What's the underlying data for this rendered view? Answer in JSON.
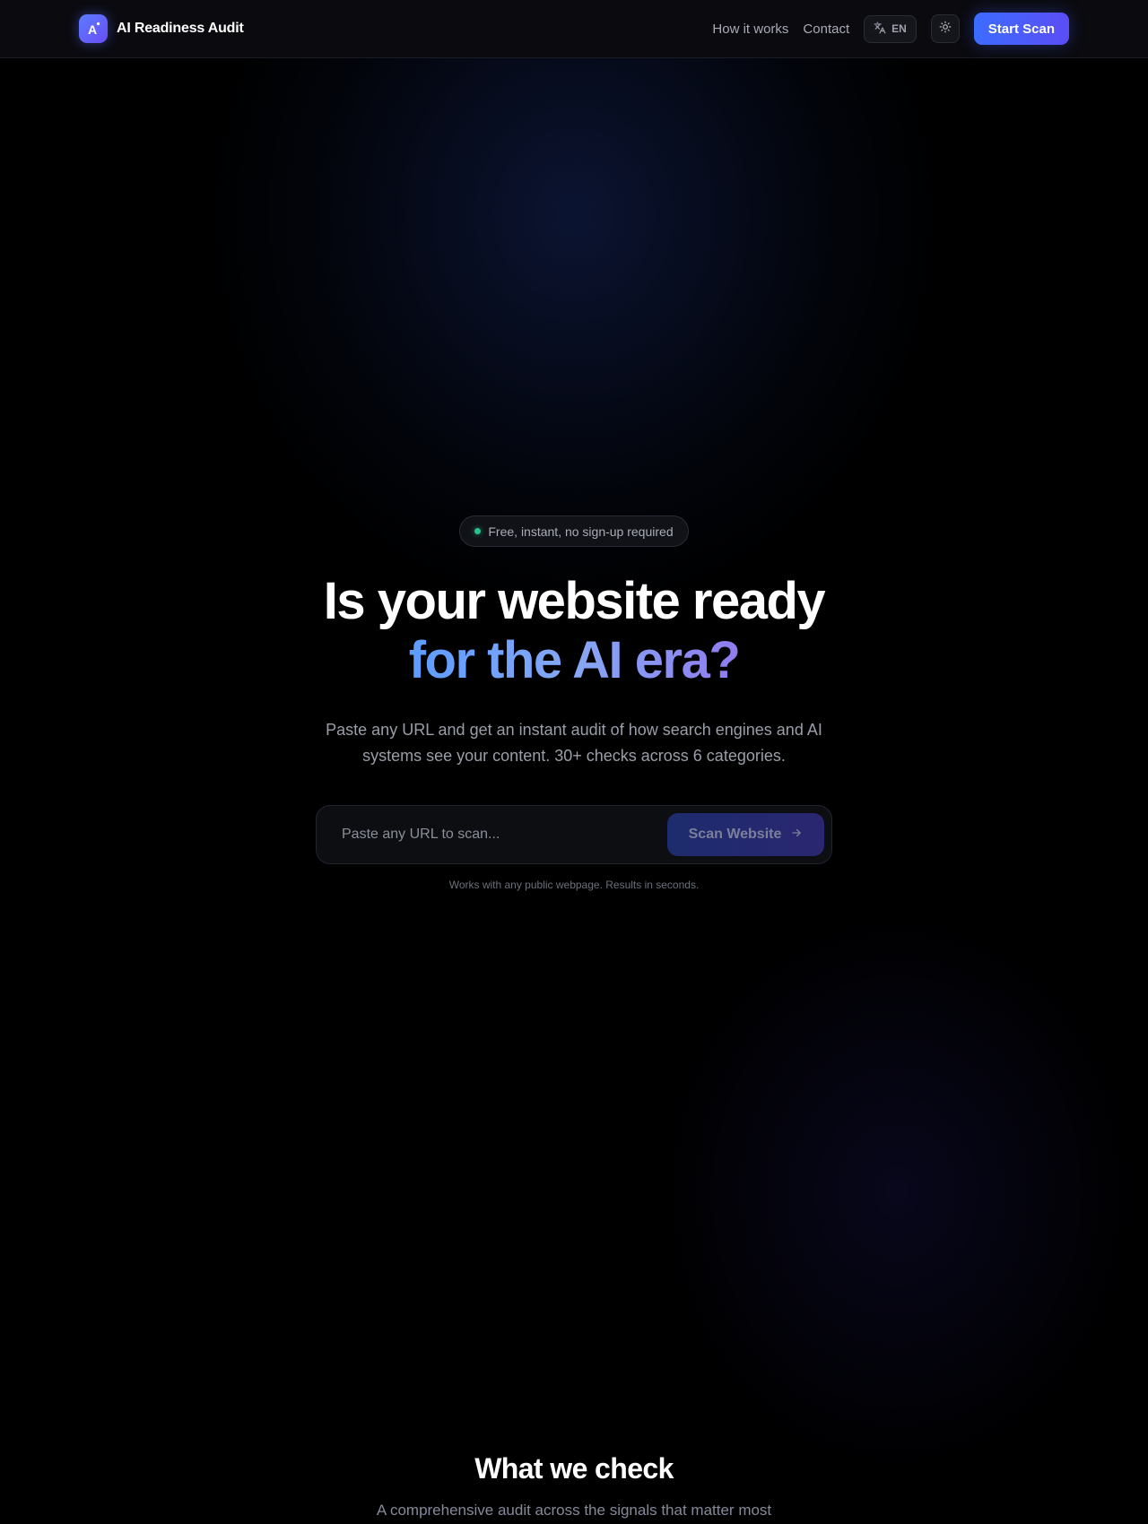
{
  "header": {
    "brand_name": "AI Readiness Audit",
    "brand_logo_letter": "A",
    "nav": {
      "how_it_works": "How it works",
      "contact": "Contact"
    },
    "language_code": "EN",
    "language_icon": "translate-icon",
    "theme_icon": "sun-icon",
    "cta_label": "Start Scan"
  },
  "hero": {
    "badge_text": "Free, instant, no sign-up required",
    "headline_line1": "Is your website ready",
    "headline_line2": "for the AI era?",
    "subtitle": "Paste any URL and get an instant audit of how search engines and AI systems see your content. 30+ checks across 6 categories.",
    "url_input": {
      "value": "",
      "placeholder": "Paste any URL to scan..."
    },
    "scan_button_label": "Scan Website",
    "scan_button_icon": "arrow-right-icon",
    "hint": "Works with any public webpage. Results in seconds."
  },
  "features_section": {
    "title": "What we check",
    "subtitle": "A comprehensive audit across the signals that matter most"
  },
  "colors": {
    "accent_start": "#3c6cff",
    "accent_end": "#5b4df5",
    "status_dot": "#25c28a",
    "headline_gradient_start": "#5d9bff",
    "headline_gradient_end": "#8f7cf0"
  }
}
